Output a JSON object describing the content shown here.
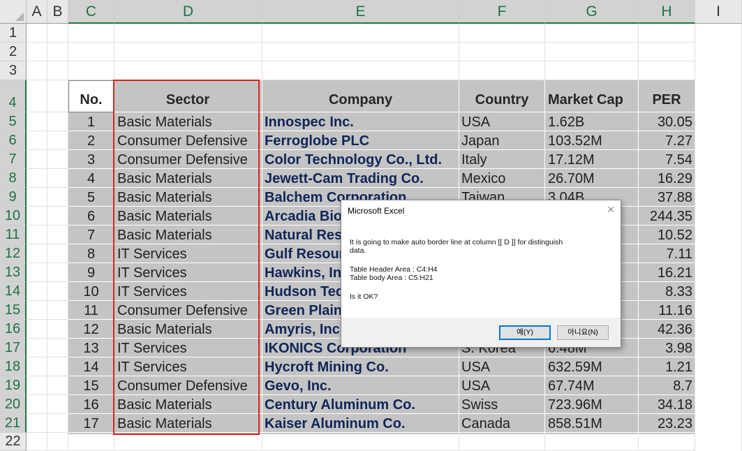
{
  "columns": [
    "A",
    "B",
    "C",
    "D",
    "E",
    "F",
    "G",
    "H",
    "I"
  ],
  "rows": [
    "1",
    "2",
    "3",
    "4",
    "5",
    "6",
    "7",
    "8",
    "9",
    "10",
    "11",
    "12",
    "13",
    "14",
    "15",
    "16",
    "17",
    "18",
    "19",
    "20",
    "21",
    "22"
  ],
  "table": {
    "headers": {
      "no": "No.",
      "sector": "Sector",
      "company": "Company",
      "country": "Country",
      "mcap": "Market Cap",
      "per": "PER"
    },
    "body": [
      {
        "no": "1",
        "sector": "Basic Materials",
        "company": "Innospec Inc.",
        "country": "USA",
        "mcap": "1.62B",
        "per": "30.05"
      },
      {
        "no": "2",
        "sector": "Consumer Defensive",
        "company": "Ferroglobe PLC",
        "country": "Japan",
        "mcap": "103.52M",
        "per": "7.27"
      },
      {
        "no": "3",
        "sector": "Consumer Defensive",
        "company": "Color Technology Co., Ltd.",
        "country": "Italy",
        "mcap": "17.12M",
        "per": "7.54"
      },
      {
        "no": "4",
        "sector": "Basic Materials",
        "company": "Jewett-Cam Trading Co.",
        "country": "Mexico",
        "mcap": "26.70M",
        "per": "16.29"
      },
      {
        "no": "5",
        "sector": "Basic Materials",
        "company": "Balchem Corporation",
        "country": "Taiwan",
        "mcap": "3.04B",
        "per": "37.88"
      },
      {
        "no": "6",
        "sector": "Basic Materials",
        "company": "Arcadia Bio",
        "country": "",
        "mcap": "",
        "per": "244.35"
      },
      {
        "no": "7",
        "sector": "Basic Materials",
        "company": "Natural Res",
        "country": "",
        "mcap": "",
        "per": "10.52"
      },
      {
        "no": "8",
        "sector": "IT Services",
        "company": "Gulf Resour",
        "country": "",
        "mcap": "",
        "per": "7.11"
      },
      {
        "no": "9",
        "sector": "IT Services",
        "company": "Hawkins, In",
        "country": "",
        "mcap": "",
        "per": "16.21"
      },
      {
        "no": "10",
        "sector": "IT Services",
        "company": "Hudson Tec",
        "country": "",
        "mcap": "",
        "per": "8.33"
      },
      {
        "no": "11",
        "sector": "Consumer Defensive",
        "company": "Green Plain",
        "country": "",
        "mcap": "",
        "per": "11.16"
      },
      {
        "no": "12",
        "sector": "Basic Materials",
        "company": "Amyris, Inc.",
        "country": "",
        "mcap": "",
        "per": "42.36"
      },
      {
        "no": "13",
        "sector": "IT Services",
        "company": "IKONICS Corporation",
        "country": "S. Korea",
        "mcap": "6.48M",
        "per": "3.98"
      },
      {
        "no": "14",
        "sector": "IT Services",
        "company": "Hycroft Mining  Co.",
        "country": "USA",
        "mcap": "632.59M",
        "per": "1.21"
      },
      {
        "no": "15",
        "sector": "Consumer Defensive",
        "company": "Gevo, Inc.",
        "country": "USA",
        "mcap": "67.74M",
        "per": "8.7"
      },
      {
        "no": "16",
        "sector": "Basic Materials",
        "company": "Century Aluminum Co.",
        "country": "Swiss",
        "mcap": "723.96M",
        "per": "34.18"
      },
      {
        "no": "17",
        "sector": "Basic Materials",
        "company": "Kaiser Aluminum Co.",
        "country": "Canada",
        "mcap": "858.51M",
        "per": "23.23"
      }
    ]
  },
  "dialog": {
    "title": "Microsoft Excel",
    "close_icon": "close-icon",
    "line1": "It is going to make auto border line at column [[ D ]] for distinguish",
    "line2": "data.",
    "line3": "Table Header Area : C4:H4",
    "line4": "Table body Area : C5:H21",
    "line5": "Is it OK?",
    "yes_label": "예(Y)",
    "no_label": "아니요(N)"
  },
  "colors": {
    "selection_accent": "#217346",
    "border_highlight": "#e02020",
    "table_fill": "#c4c4c4",
    "company_text": "#0f2557"
  }
}
